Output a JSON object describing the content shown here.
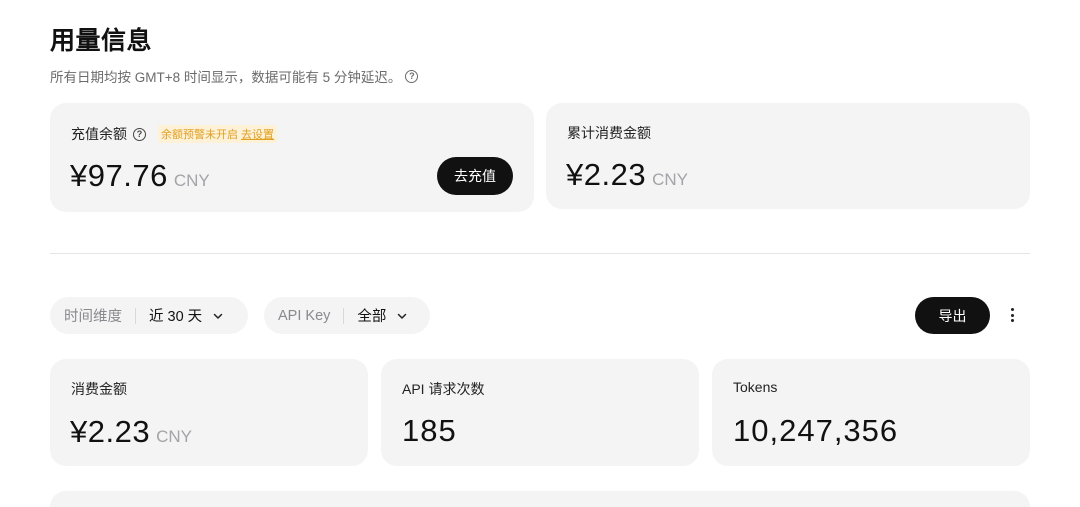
{
  "header": {
    "title": "用量信息",
    "subtitle": "所有日期均按 GMT+8 时间显示，数据可能有 5 分钟延迟。"
  },
  "balance_card": {
    "label": "充值余额",
    "warning_text": "余额预警未开启",
    "warning_link": "去设置",
    "amount": "¥97.76",
    "currency": "CNY",
    "recharge_button": "去充值"
  },
  "total_spend_card": {
    "label": "累计消费金额",
    "amount": "¥2.23",
    "currency": "CNY"
  },
  "filters": {
    "time_label": "时间维度",
    "time_value": "近 30 天",
    "apikey_label": "API Key",
    "apikey_value": "全部",
    "export_button": "导出"
  },
  "stats": {
    "spend_label": "消费金额",
    "spend_amount": "¥2.23",
    "spend_currency": "CNY",
    "requests_label": "API 请求次数",
    "requests_value": "185",
    "tokens_label": "Tokens",
    "tokens_value": "10,247,356"
  },
  "colors": {
    "accent_dark": "#111111",
    "card_bg": "#f4f4f5",
    "warning": "#e2a020"
  },
  "icons": [
    "help-circle-icon",
    "chevron-down-icon",
    "more-vertical-icon"
  ]
}
